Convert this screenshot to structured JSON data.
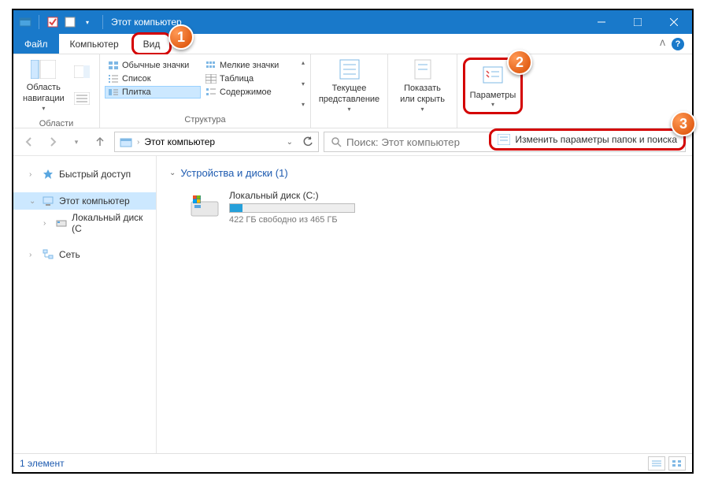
{
  "window": {
    "title": "Этот компьютер"
  },
  "tabs": {
    "file": "Файл",
    "computer": "Компьютер",
    "view": "Вид"
  },
  "ribbon": {
    "panes_group": "Области",
    "layout_group": "Структура",
    "nav_pane_label": "Область\nнавигации",
    "layout_items": {
      "regular_icons": "Обычные значки",
      "small_icons": "Мелкие значки",
      "list": "Список",
      "table": "Таблица",
      "tiles": "Плитка",
      "content": "Содержимое"
    },
    "current_view": "Текущее\nпредставление",
    "show_hide": "Показать\nили скрыть",
    "options": "Параметры",
    "options_menu": "Изменить параметры папок и поиска"
  },
  "address": {
    "location": "Этот компьютер",
    "search_placeholder": "Поиск: Этот компьютер"
  },
  "sidebar": {
    "quick_access": "Быстрый доступ",
    "this_pc": "Этот компьютер",
    "local_disk": "Локальный диск (C",
    "network": "Сеть"
  },
  "content": {
    "section_title": "Устройства и диски (1)",
    "drive_name": "Локальный диск (C:)",
    "drive_free": "422 ГБ свободно из 465 ГБ"
  },
  "statusbar": {
    "count": "1 элемент"
  },
  "callouts": {
    "c1": "1",
    "c2": "2",
    "c3": "3"
  }
}
